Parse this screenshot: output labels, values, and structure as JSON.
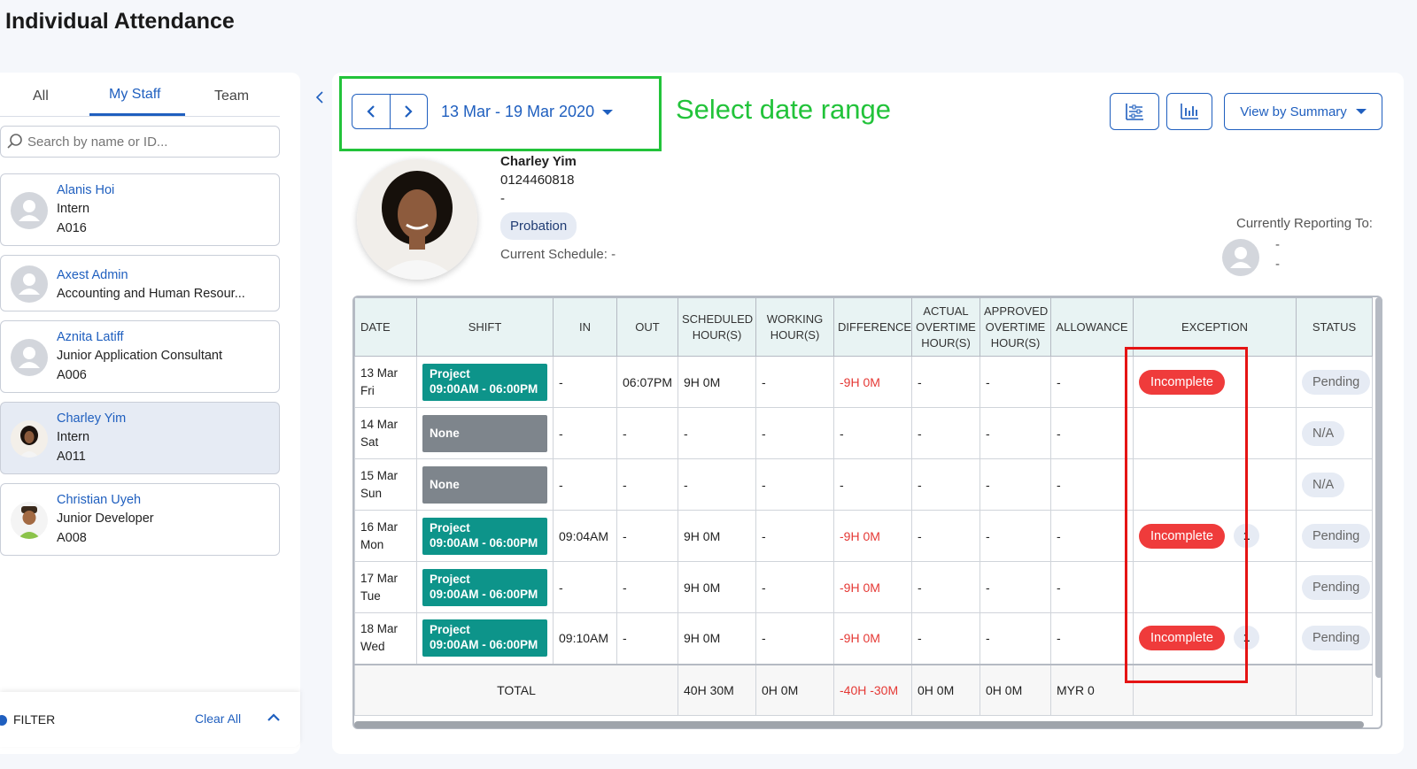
{
  "page": {
    "title": "Individual Attendance"
  },
  "sidebar": {
    "tabs": [
      {
        "label": "All"
      },
      {
        "label": "My Staff",
        "active": true
      },
      {
        "label": "Team"
      }
    ],
    "search_placeholder": "Search by name or ID...",
    "staff": [
      {
        "name": "Alanis Hoi",
        "role": "Intern",
        "id": "A016"
      },
      {
        "name": "Axest Admin",
        "role": "Accounting and Human Resour..."
      },
      {
        "name": "Aznita Latiff",
        "role": "Junior Application Consultant",
        "id": "A006"
      },
      {
        "name": "Charley Yim",
        "role": "Intern",
        "id": "A011",
        "selected": true
      },
      {
        "name": "Christian Uyeh",
        "role": "Junior Developer",
        "id": "A008"
      }
    ],
    "filter": {
      "label": "FILTER",
      "clear_label": "Clear All"
    }
  },
  "toolbar": {
    "date_range": "13 Mar - 19 Mar 2020",
    "annotation": "Select date range",
    "view_label": "View by Summary"
  },
  "profile": {
    "name": "Charley Yim",
    "phone": "0124460818",
    "extra": "-",
    "badge": "Probation",
    "schedule": "Current Schedule: -",
    "reporting_label": "Currently Reporting To:",
    "reporting_line1": "-",
    "reporting_line2": "-"
  },
  "table": {
    "headers": {
      "date": "DATE",
      "shift": "SHIFT",
      "in": "IN",
      "out": "OUT",
      "scheduled": "SCHEDULED HOUR(S)",
      "working": "WORKING HOUR(S)",
      "difference": "DIFFERENCE",
      "actual_ot": "ACTUAL OVERTIME HOUR(S)",
      "approved_ot": "APPROVED OVERTIME HOUR(S)",
      "allowance": "ALLOWANCE",
      "exception": "EXCEPTION",
      "status": "STATUS"
    },
    "rows": [
      {
        "day": "13 Mar",
        "weekday": "Fri",
        "shift_title": "Project",
        "shift_time": "09:00AM - 06:00PM",
        "in": "-",
        "out": "06:07PM",
        "scheduled": "9H 0M",
        "working": "-",
        "difference": "-9H 0M",
        "actual_ot": "-",
        "approved_ot": "-",
        "allowance": "-",
        "exception": "Incomplete",
        "count": "",
        "status": "Pending"
      },
      {
        "day": "14 Mar",
        "weekday": "Sat",
        "shift_title": "None",
        "shift_time": "",
        "in": "-",
        "out": "-",
        "scheduled": "-",
        "working": "-",
        "difference": "-",
        "actual_ot": "-",
        "approved_ot": "-",
        "allowance": "-",
        "exception": "",
        "count": "",
        "status": "N/A"
      },
      {
        "day": "15 Mar",
        "weekday": "Sun",
        "shift_title": "None",
        "shift_time": "",
        "in": "-",
        "out": "-",
        "scheduled": "-",
        "working": "-",
        "difference": "-",
        "actual_ot": "-",
        "approved_ot": "-",
        "allowance": "-",
        "exception": "",
        "count": "",
        "status": "N/A"
      },
      {
        "day": "16 Mar",
        "weekday": "Mon",
        "shift_title": "Project",
        "shift_time": "09:00AM - 06:00PM",
        "in": "09:04AM",
        "out": "-",
        "scheduled": "9H 0M",
        "working": "-",
        "difference": "-9H 0M",
        "actual_ot": "-",
        "approved_ot": "-",
        "allowance": "-",
        "exception": "Incomplete",
        "count": "1",
        "status": "Pending"
      },
      {
        "day": "17 Mar",
        "weekday": "Tue",
        "shift_title": "Project",
        "shift_time": "09:00AM - 06:00PM",
        "in": "-",
        "out": "-",
        "scheduled": "9H 0M",
        "working": "-",
        "difference": "-9H 0M",
        "actual_ot": "-",
        "approved_ot": "-",
        "allowance": "-",
        "exception": "",
        "count": "",
        "status": "Pending"
      },
      {
        "day": "18 Mar",
        "weekday": "Wed",
        "shift_title": "Project",
        "shift_time": "09:00AM - 06:00PM",
        "in": "09:10AM",
        "out": "-",
        "scheduled": "9H 0M",
        "working": "-",
        "difference": "-9H 0M",
        "actual_ot": "-",
        "approved_ot": "-",
        "allowance": "-",
        "exception": "Incomplete",
        "count": "1",
        "status": "Pending"
      }
    ],
    "total": {
      "label": "TOTAL",
      "scheduled": "40H 30M",
      "working": "0H 0M",
      "difference": "-40H -30M",
      "actual_ot": "0H 0M",
      "approved_ot": "0H 0M",
      "allowance": "MYR 0"
    }
  },
  "colors": {
    "accent": "#1f5fbf",
    "shift_project": "#0d948a",
    "shift_none": "#7e858c",
    "exception": "#ef3b3b",
    "annotation_green": "#22c33a",
    "highlight_red": "#e51414"
  }
}
